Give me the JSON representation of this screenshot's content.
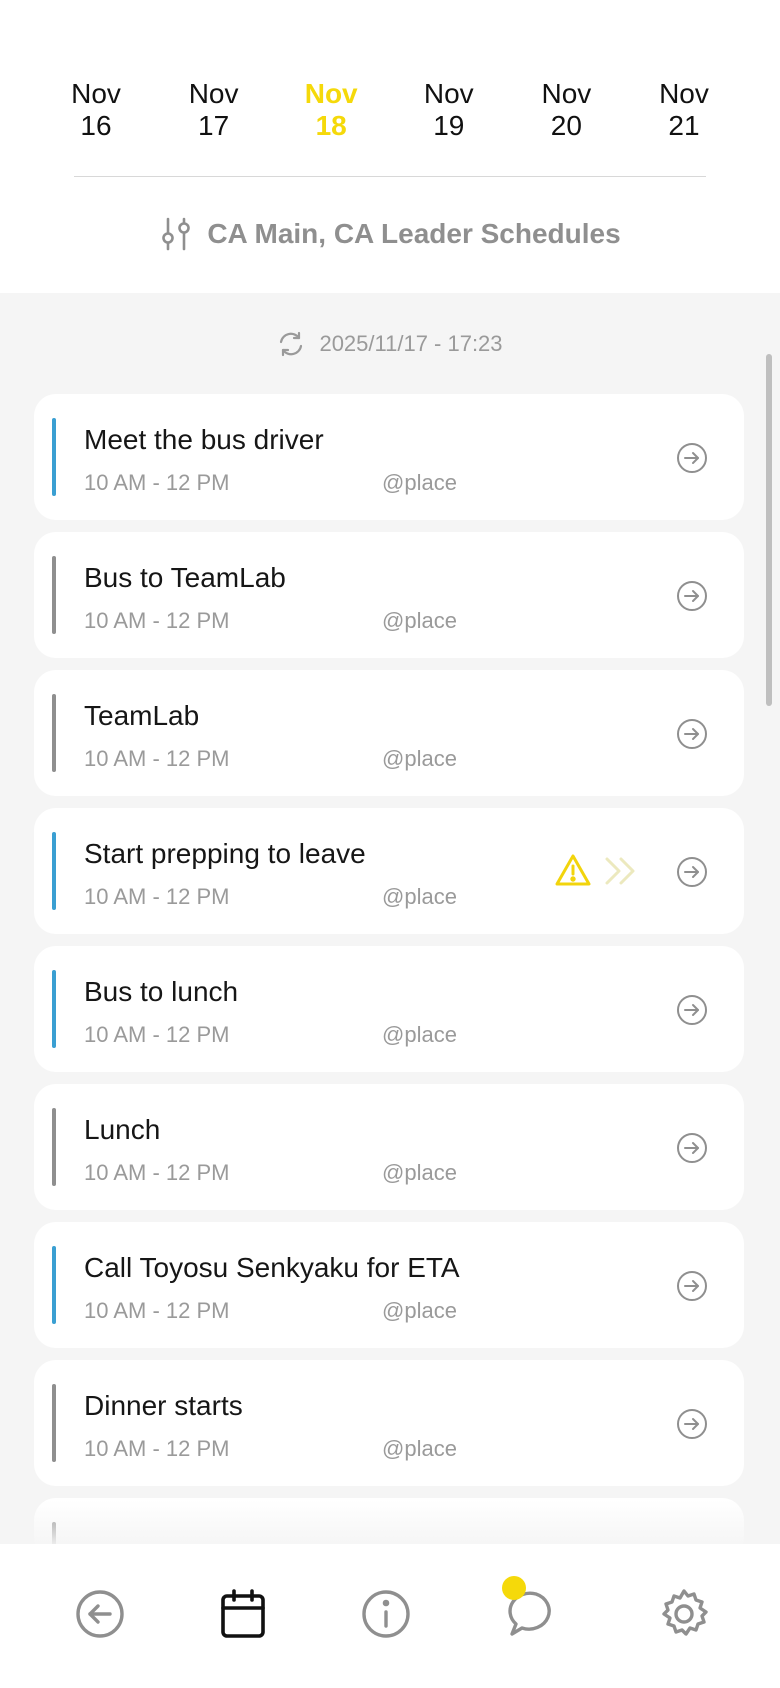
{
  "dates": [
    {
      "month": "Nov",
      "day": "16",
      "selected": false
    },
    {
      "month": "Nov",
      "day": "17",
      "selected": false
    },
    {
      "month": "Nov",
      "day": "18",
      "selected": true
    },
    {
      "month": "Nov",
      "day": "19",
      "selected": false
    },
    {
      "month": "Nov",
      "day": "20",
      "selected": false
    },
    {
      "month": "Nov",
      "day": "21",
      "selected": false
    }
  ],
  "filter": {
    "label": "CA Main, CA Leader Schedules",
    "icon": "filter-sliders-icon"
  },
  "sync": {
    "timestamp": "2025/11/17 - 17:23",
    "icon": "refresh-icon"
  },
  "events": [
    {
      "title": "Meet the bus driver",
      "time": "10 AM - 12 PM",
      "place": "@place",
      "accent": true
    },
    {
      "title": "Bus to TeamLab",
      "time": "10 AM - 12 PM",
      "place": "@place",
      "accent": false
    },
    {
      "title": "TeamLab",
      "time": "10 AM - 12 PM",
      "place": "@place",
      "accent": false
    },
    {
      "title": "Start prepping to leave",
      "time": "10 AM - 12 PM",
      "place": "@place",
      "accent": true,
      "warning": true
    },
    {
      "title": "Bus to lunch",
      "time": "10 AM - 12 PM",
      "place": "@place",
      "accent": true
    },
    {
      "title": "Lunch",
      "time": "10 AM - 12 PM",
      "place": "@place",
      "accent": false
    },
    {
      "title": "Call Toyosu Senkyaku for ETA",
      "time": "10 AM - 12 PM",
      "place": "@place",
      "accent": true
    },
    {
      "title": "Dinner starts",
      "time": "10 AM - 12 PM",
      "place": "@place",
      "accent": false
    }
  ],
  "colors": {
    "selected_date": "#f5d90a",
    "accent_bar": "#3a9fd2",
    "neutral_bar": "#8f8f8f",
    "warning": "#f2d40c"
  },
  "tabs": [
    {
      "name": "back-icon"
    },
    {
      "name": "calendar-icon",
      "active": true
    },
    {
      "name": "info-icon"
    },
    {
      "name": "chat-icon",
      "badge": true
    },
    {
      "name": "settings-icon"
    }
  ]
}
